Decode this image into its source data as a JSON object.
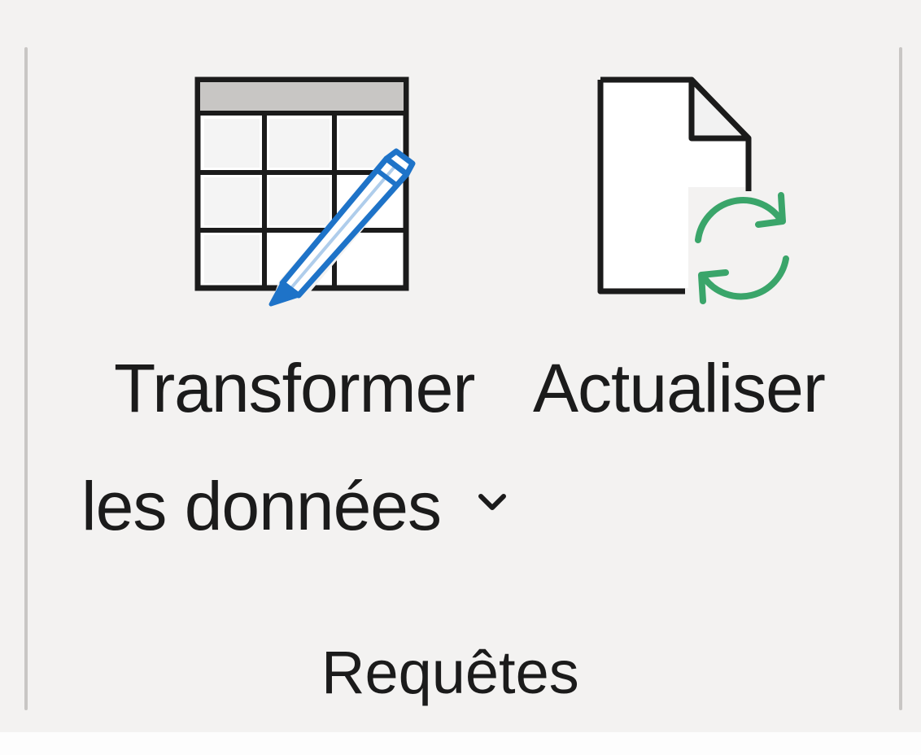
{
  "ribbon_group": {
    "name": "Requêtes",
    "buttons": [
      {
        "id": "transform-data",
        "label_line1": "Transformer",
        "label_line2": "les données",
        "has_dropdown": true,
        "icon": "table-edit-icon"
      },
      {
        "id": "refresh",
        "label_line1": "Actualiser",
        "has_dropdown": false,
        "icon": "document-refresh-icon"
      }
    ]
  },
  "colors": {
    "background": "#f3f2f1",
    "text": "#1b1b1b",
    "separator": "#c8c6c4",
    "pencil_accent": "#1e73c8",
    "refresh_accent": "#3aa56a"
  }
}
